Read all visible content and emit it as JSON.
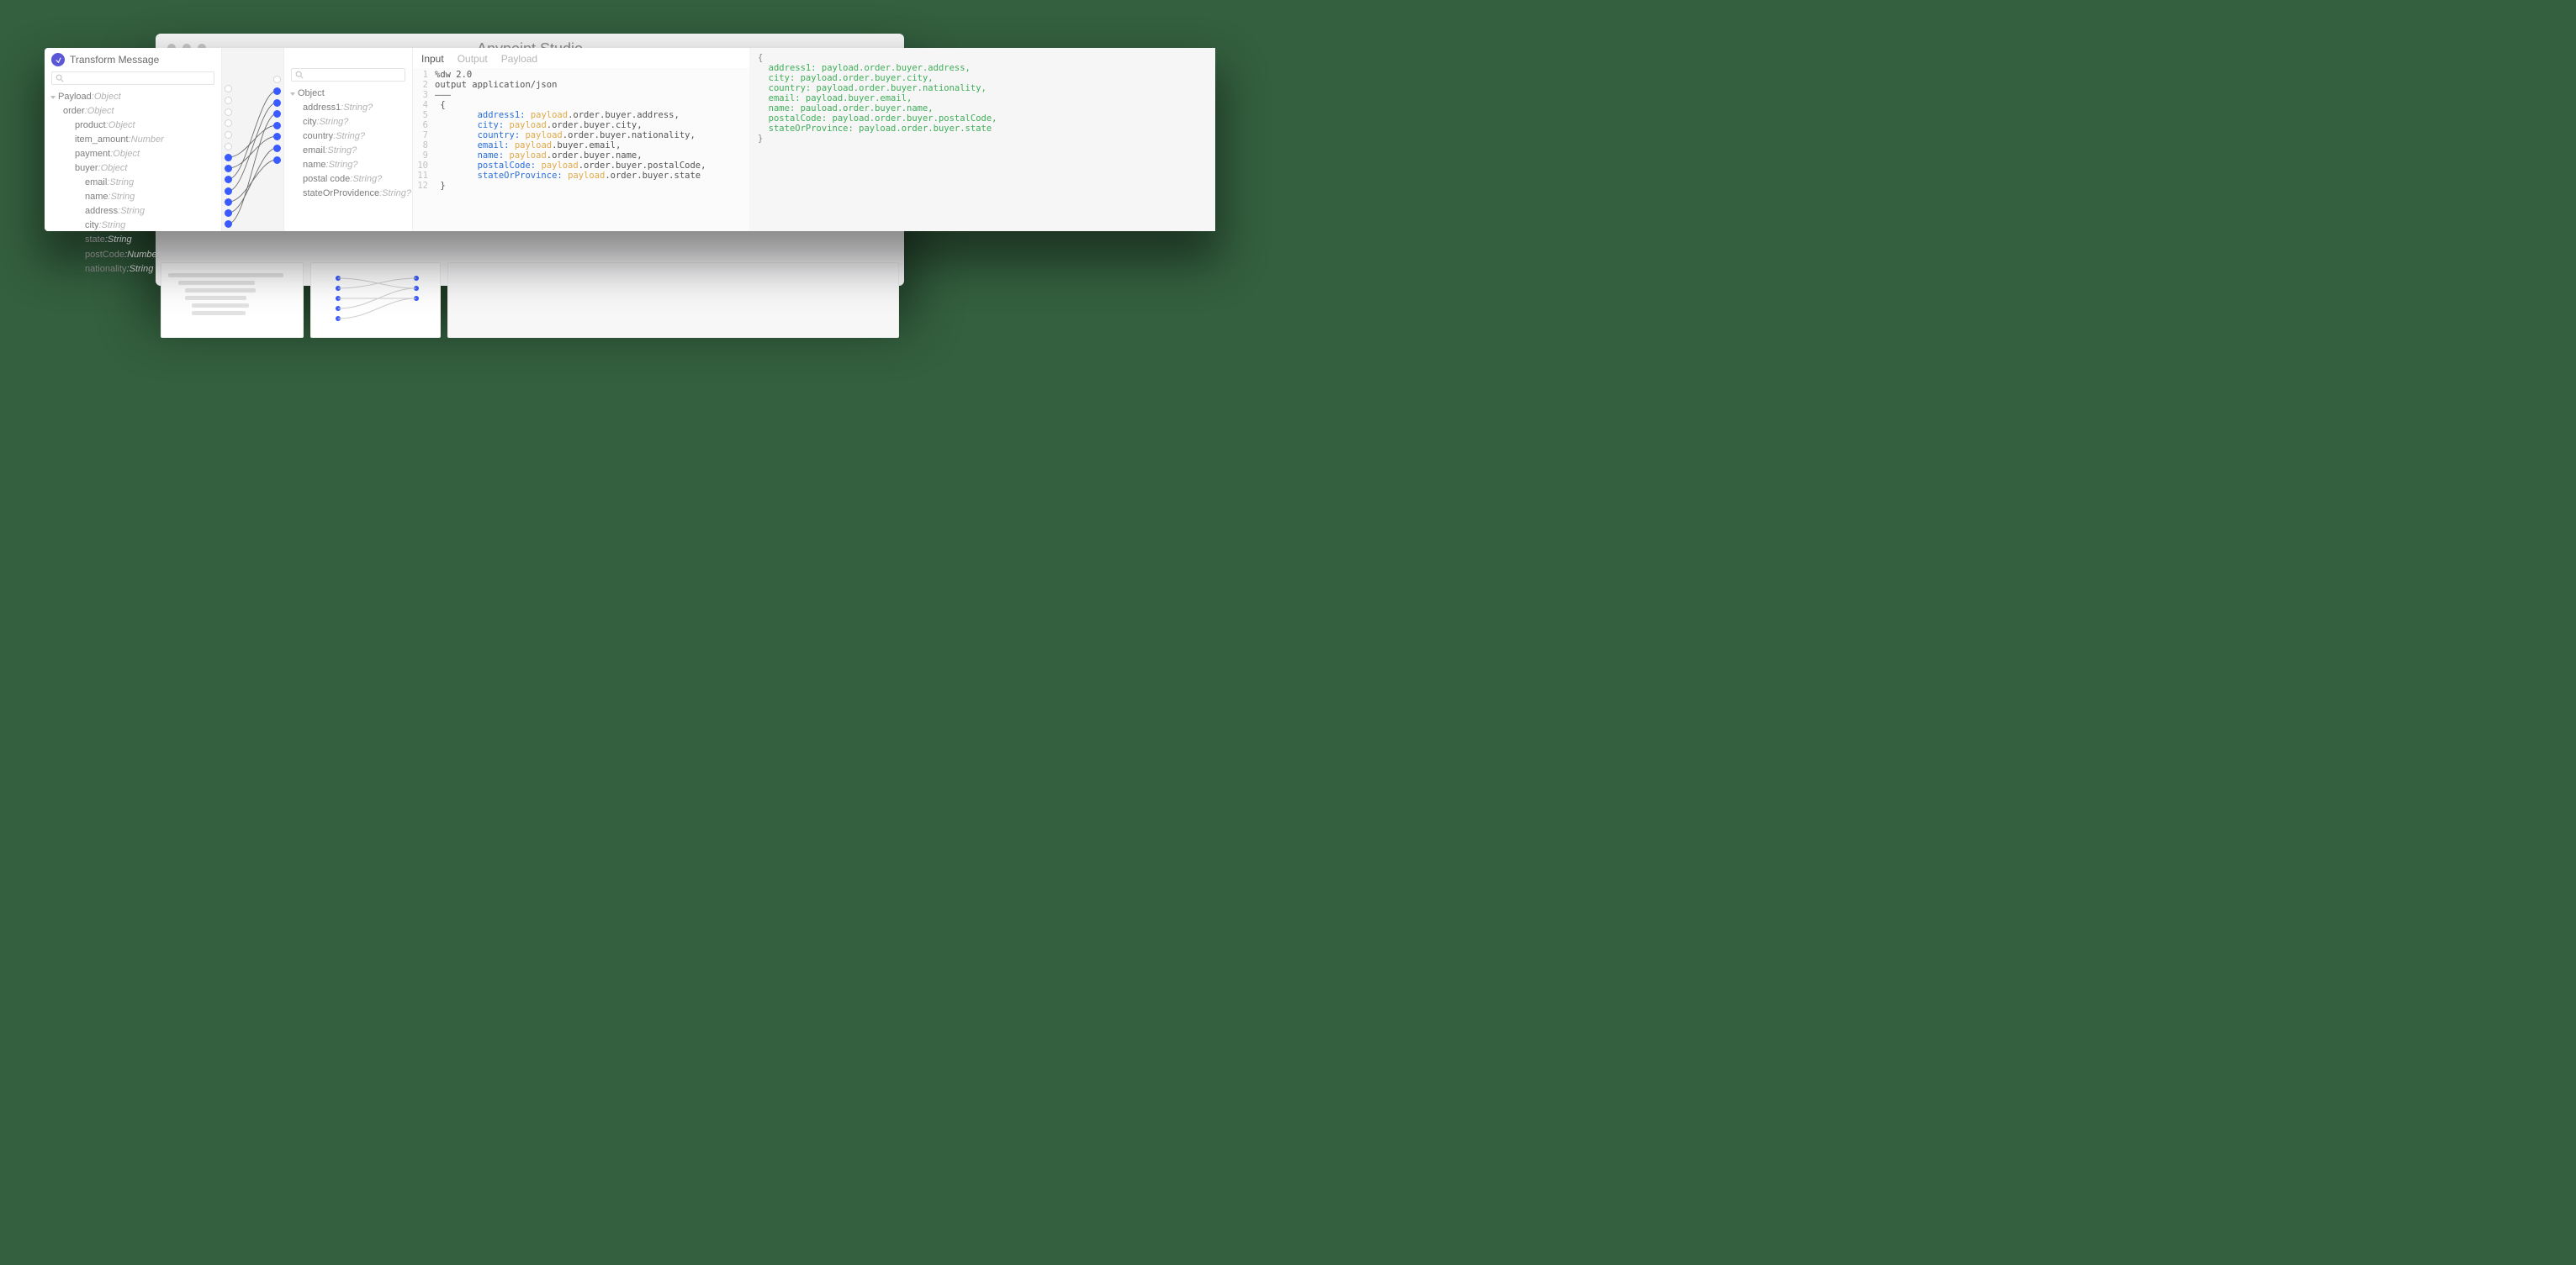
{
  "app_title": "Anypoint Studio",
  "panel": {
    "title": "Transform Message"
  },
  "tabs": {
    "input": "Input",
    "output": "Output",
    "payload": "Payload"
  },
  "input_tree": {
    "root": "Payload",
    "root_type": "Object",
    "order": "order",
    "order_type": "Object",
    "product": "product",
    "product_type": "Object",
    "item_amount": "item_amount",
    "item_amount_type": "Number",
    "payment": "payment",
    "payment_type": "Object",
    "buyer": "buyer",
    "buyer_type": "Object",
    "email": "email",
    "email_type": "String",
    "name": "name",
    "name_type": "String",
    "address": "address",
    "address_type": "String",
    "city": "city",
    "city_type": "String",
    "state": "state",
    "state_type": "String",
    "postCode": "postCode",
    "postCode_type": "Number",
    "nationality": "nationality",
    "nationality_type": "String"
  },
  "output_tree": {
    "root": "Object",
    "address1": "address1",
    "address1_type": "String?",
    "city": "city",
    "city_type": "String?",
    "country": "country",
    "country_type": "String?",
    "email": "email",
    "email_type": "String?",
    "name": "name",
    "name_type": "String?",
    "postal": "postal code",
    "postal_type": "String?",
    "state": "stateOrProvidence",
    "state_type": "String?"
  },
  "mappings": [
    {
      "from": "email",
      "to": "email"
    },
    {
      "from": "name",
      "to": "name"
    },
    {
      "from": "address",
      "to": "address1"
    },
    {
      "from": "city",
      "to": "city"
    },
    {
      "from": "state",
      "to": "state"
    },
    {
      "from": "postCode",
      "to": "postal"
    },
    {
      "from": "nationality",
      "to": "country"
    }
  ],
  "code": {
    "l1": "%dw 2.0",
    "l2": "output application/json",
    "l3": "———",
    "l5k": "address1:",
    "l5p": ".order.buyer.address,",
    "l6k": "city:",
    "l6p": ".order.buyer.city,",
    "l7k": "country:",
    "l7p": ".order.buyer.nationality,",
    "l8k": "email:",
    "l8p": ".buyer.email,",
    "l9k": "name:",
    "l9p": ".order.buyer.name,",
    "l10k": "postalCode:",
    "l10p": ".order.buyer.postalCode,",
    "l11k": "stateOrProvince:",
    "l11p": ".order.buyer.state",
    "payload_word": "payload"
  },
  "json_out": {
    "l1": "address1: payload.order.buyer.address,",
    "l2": "city: payload.order.buyer.city,",
    "l3": "country: payload.order.buyer.nationality,",
    "l4": "email: payload.buyer.email,",
    "l5": "name: pauload.order.buyer.name,",
    "l6": "postalCode: payload.order.buyer.postalCode,",
    "l7": "stateOrProvince: payload.order.buyer.state"
  }
}
